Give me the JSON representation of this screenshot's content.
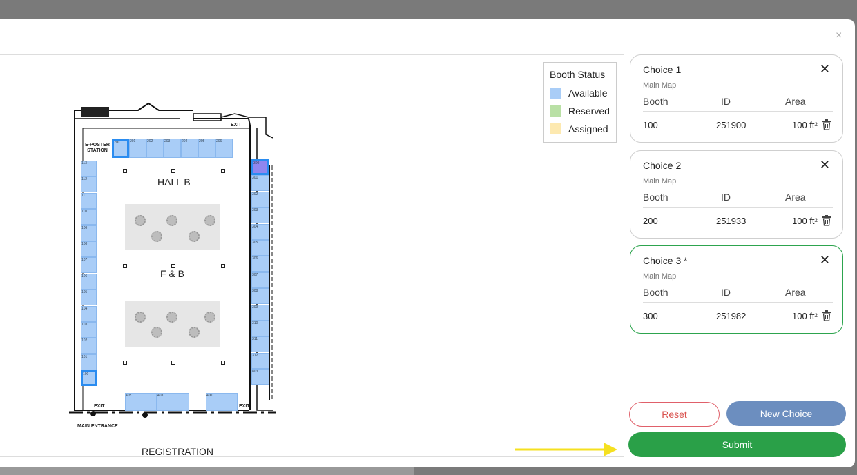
{
  "modal": {
    "close_glyph": "×"
  },
  "legend": {
    "title": "Booth Status",
    "items": [
      {
        "label": "Available",
        "color": "#a9cdf7"
      },
      {
        "label": "Reserved",
        "color": "#b9e0a5"
      },
      {
        "label": "Assigned",
        "color": "#fde9b0"
      }
    ]
  },
  "map": {
    "hall_label": "HALL B",
    "fb_label": "F & B",
    "registration_label": "REGISTRATION",
    "main_entrance_label": "MAIN ENTRANCE",
    "eposter_label": "E-POSTER STATION",
    "exit_label": "EXIT",
    "top_booths": [
      "200",
      "201",
      "202",
      "203",
      "204",
      "205",
      "206"
    ],
    "left_booths": [
      "113",
      "112",
      "111",
      "110",
      "109",
      "108",
      "107",
      "106",
      "105",
      "104",
      "103",
      "102",
      "101",
      "100"
    ],
    "right_booths": [
      "300",
      "301",
      "302",
      "303",
      "304",
      "305",
      "306",
      "307",
      "308",
      "309",
      "310",
      "311",
      "312",
      "803"
    ],
    "bottom_booths": [
      "405",
      "403",
      "400"
    ]
  },
  "choices": [
    {
      "title": "Choice 1",
      "subtitle": "Main Map",
      "col_booth": "Booth",
      "col_id": "ID",
      "col_area": "Area",
      "booth": "100",
      "id": "251900",
      "area": "100 ft²",
      "active": false
    },
    {
      "title": "Choice 2",
      "subtitle": "Main Map",
      "col_booth": "Booth",
      "col_id": "ID",
      "col_area": "Area",
      "booth": "200",
      "id": "251933",
      "area": "100 ft²",
      "active": false
    },
    {
      "title": "Choice 3 *",
      "subtitle": "Main Map",
      "col_booth": "Booth",
      "col_id": "ID",
      "col_area": "Area",
      "booth": "300",
      "id": "251982",
      "area": "100 ft²",
      "active": true
    }
  ],
  "buttons": {
    "reset": "Reset",
    "new_choice": "New Choice",
    "submit": "Submit"
  },
  "colors": {
    "accent_green": "#2aa048",
    "accent_blue": "#6c8ebf",
    "danger": "#d9534f",
    "arrow": "#f5e020"
  }
}
